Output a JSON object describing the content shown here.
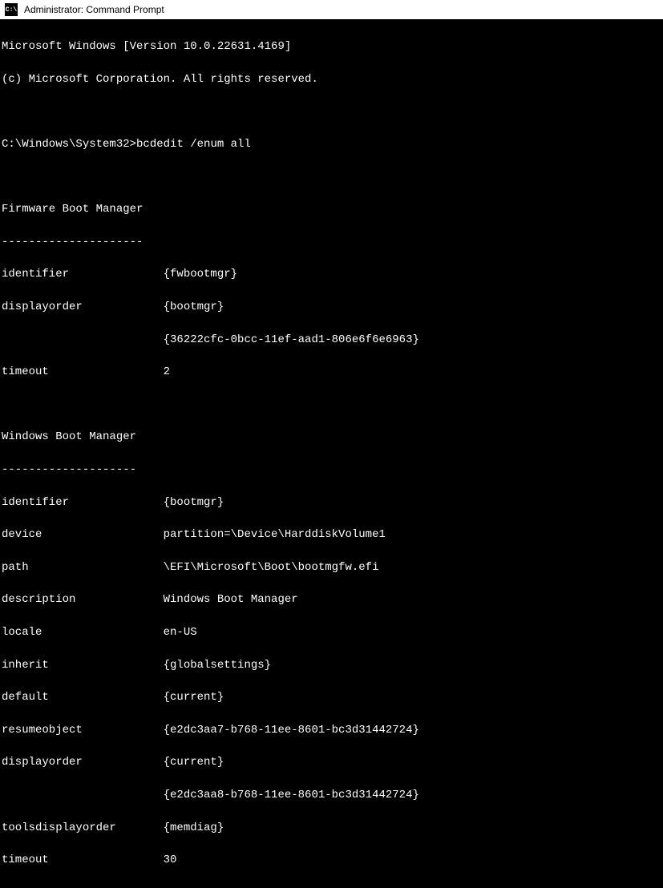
{
  "titlebar": {
    "icon_text": "C:\\",
    "title": "Administrator: Command Prompt"
  },
  "header": {
    "line1": "Microsoft Windows [Version 10.0.22631.4169]",
    "line2": "(c) Microsoft Corporation. All rights reserved."
  },
  "prompt": {
    "path": "C:\\Windows\\System32>",
    "command": "bcdedit /enum all"
  },
  "sections": {
    "fbm": {
      "title": "Firmware Boot Manager",
      "sep": "---------------------",
      "identifier_k": "identifier",
      "identifier_v": "{fwbootmgr}",
      "displayorder_k": "displayorder",
      "displayorder_v1": "{bootmgr}",
      "displayorder_v2": "{36222cfc-0bcc-11ef-aad1-806e6f6e6963}",
      "timeout_k": "timeout",
      "timeout_v": "2"
    },
    "wbm": {
      "title": "Windows Boot Manager",
      "sep": "--------------------",
      "identifier_k": "identifier",
      "identifier_v": "{bootmgr}",
      "device_k": "device",
      "device_v": "partition=\\Device\\HarddiskVolume1",
      "path_k": "path",
      "path_v": "\\EFI\\Microsoft\\Boot\\bootmgfw.efi",
      "description_k": "description",
      "description_v": "Windows Boot Manager",
      "locale_k": "locale",
      "locale_v": "en-US",
      "inherit_k": "inherit",
      "inherit_v": "{globalsettings}",
      "default_k": "default",
      "default_v": "{current}",
      "resumeobject_k": "resumeobject",
      "resumeobject_v": "{e2dc3aa7-b768-11ee-8601-bc3d31442724}",
      "displayorder_k": "displayorder",
      "displayorder_v1": "{current}",
      "displayorder_v2": "{e2dc3aa8-b768-11ee-8601-bc3d31442724}",
      "toolsdisplayorder_k": "toolsdisplayorder",
      "toolsdisplayorder_v": "{memdiag}",
      "timeout_k": "timeout",
      "timeout_v": "30"
    }
  }
}
